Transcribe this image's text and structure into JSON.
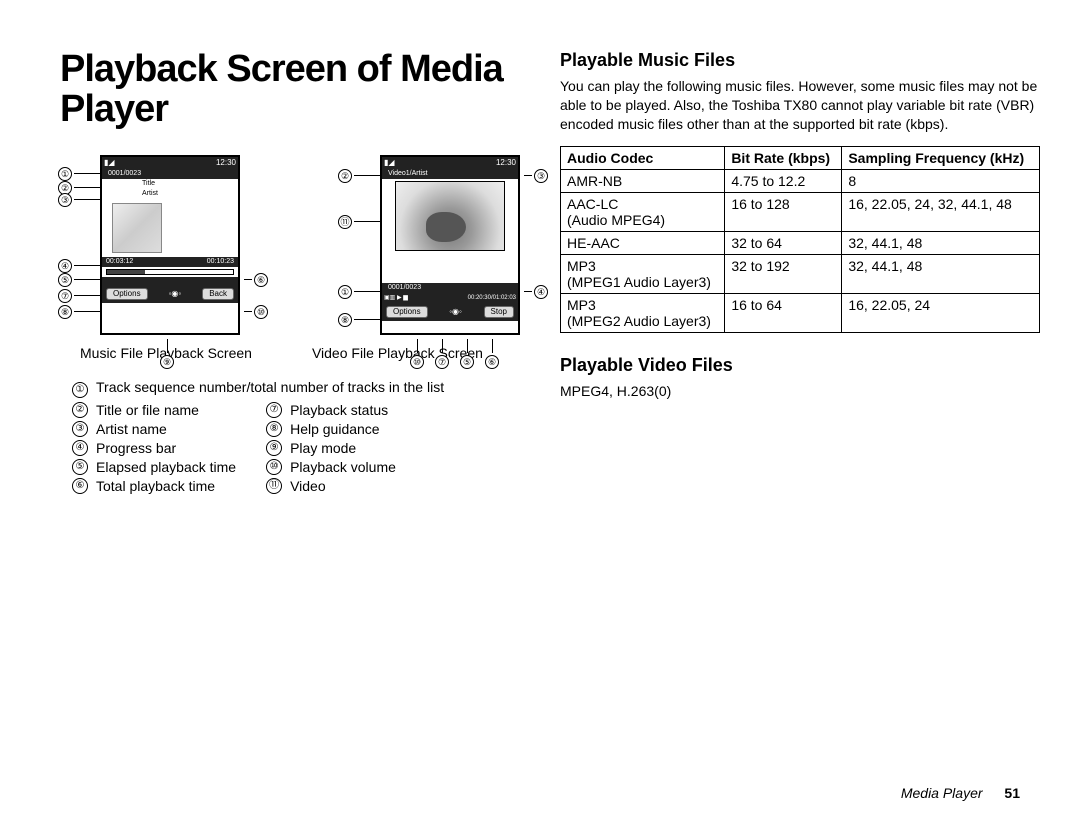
{
  "title": "Playback Screen of Media Player",
  "music_screen": {
    "caption": "Music File Playback Screen",
    "clock": "12:30",
    "track_counter": "0001/0023",
    "title_label": "Title",
    "artist_label": "Artist",
    "elapsed": "00:03:12",
    "total": "00:10:23",
    "left_softkey": "Options",
    "right_softkey": "Back"
  },
  "video_screen": {
    "caption": "Video File Playback Screen",
    "clock": "12:30",
    "header": "Video1/Artist",
    "track_counter": "0001/0023",
    "time_info": "00:20:30/01:02:03",
    "left_softkey": "Options",
    "right_softkey": "Stop"
  },
  "legend_wide": "Track sequence number/total number of tracks in the list",
  "legend_left": [
    "Title or file name",
    "Artist name",
    "Progress bar",
    "Elapsed playback time",
    "Total playback time"
  ],
  "legend_right": [
    "Playback status",
    "Help guidance",
    "Play mode",
    "Playback volume",
    "Video"
  ],
  "legend_nums_left": [
    "②",
    "③",
    "④",
    "⑤",
    "⑥"
  ],
  "legend_nums_right": [
    "⑦",
    "⑧",
    "⑨",
    "⑩",
    "⑪"
  ],
  "music_files": {
    "heading": "Playable Music Files",
    "intro": "You can play the following music files. However, some music files may not be able to be played. Also, the Toshiba TX80 cannot play variable bit rate (VBR) encoded music files other than at the supported bit rate (kbps).",
    "headers": [
      "Audio Codec",
      "Bit Rate (kbps)",
      "Sampling Frequency (kHz)"
    ],
    "rows": [
      {
        "codec": "AMR-NB",
        "sub": "",
        "bitrate": "4.75 to 12.2",
        "freq": "8"
      },
      {
        "codec": "AAC-LC",
        "sub": "(Audio MPEG4)",
        "bitrate": "16 to 128",
        "freq": "16, 22.05, 24, 32, 44.1, 48"
      },
      {
        "codec": "HE-AAC",
        "sub": "",
        "bitrate": "32 to 64",
        "freq": "32, 44.1, 48"
      },
      {
        "codec": "MP3",
        "sub": "(MPEG1 Audio Layer3)",
        "bitrate": "32 to 192",
        "freq": "32, 44.1, 48"
      },
      {
        "codec": "MP3",
        "sub": "(MPEG2 Audio Layer3)",
        "bitrate": "16 to 64",
        "freq": "16, 22.05, 24"
      }
    ]
  },
  "video_files": {
    "heading": "Playable Video Files",
    "body": "MPEG4, H.263(0)"
  },
  "footer": {
    "section": "Media Player",
    "page": "51"
  },
  "circled": [
    "①",
    "②",
    "③",
    "④",
    "⑤",
    "⑥",
    "⑦",
    "⑧",
    "⑨",
    "⑩",
    "⑪"
  ]
}
